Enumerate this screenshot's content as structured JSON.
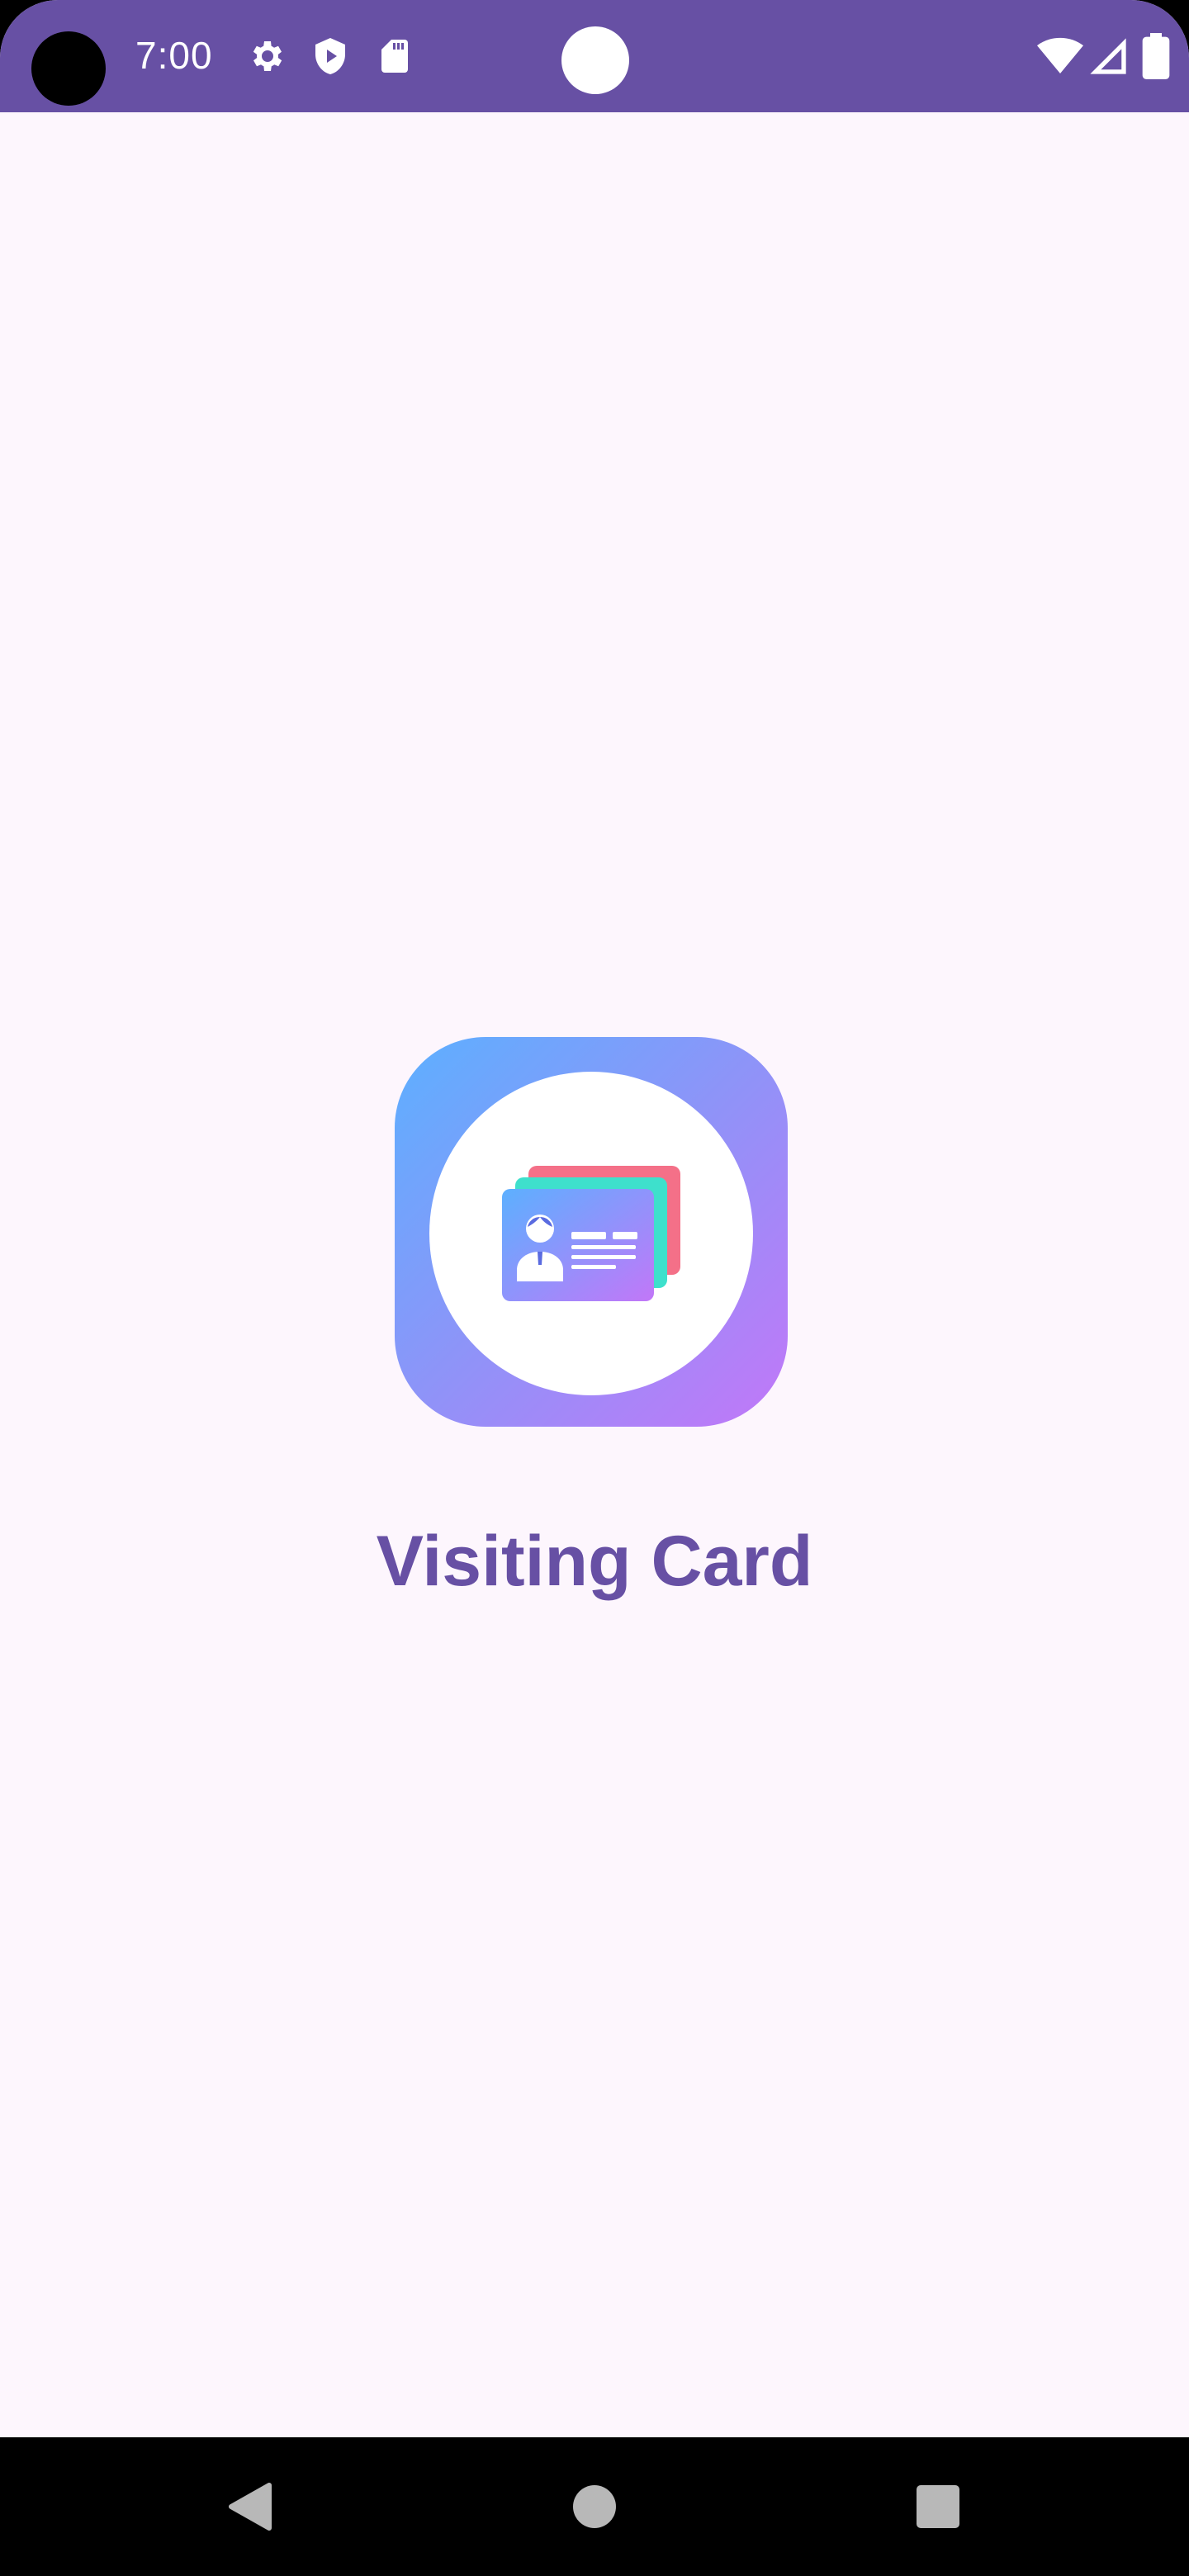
{
  "status_bar": {
    "time": "7:00",
    "left_icons": [
      "gear-icon",
      "shield-play-icon",
      "sd-card-icon"
    ],
    "right_icons": [
      "wifi-icon",
      "signal-icon",
      "battery-icon"
    ],
    "color": "#6750a4"
  },
  "main": {
    "logo": "visiting-card-logo-icon",
    "title": "Visiting Card"
  },
  "nav_bar": {
    "buttons": [
      "back-icon",
      "home-icon",
      "recents-icon"
    ]
  },
  "colors": {
    "accent": "#6750a4",
    "background": "#fdf6fd"
  }
}
